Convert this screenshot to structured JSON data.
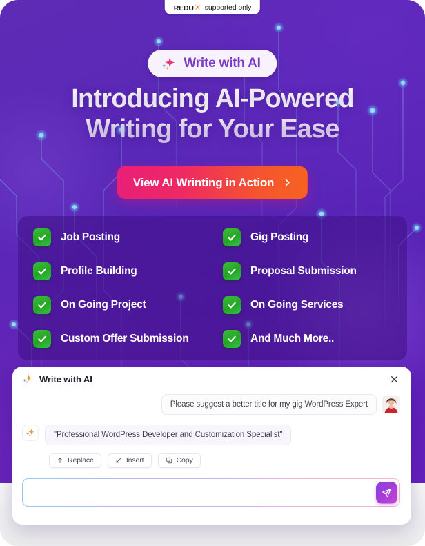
{
  "badge": {
    "brand": "REDU",
    "brand_mark": "X",
    "note": "supported only",
    "colors": {
      "mark_start": "#f5c518",
      "mark_mid": "#f0722c",
      "mark_end": "#e8327c"
    }
  },
  "pill": {
    "label": "Write with AI",
    "icon": "sparkle-icon",
    "text_color": "#7a3cc4"
  },
  "hero": {
    "headline_line1": "Introducing AI-Powered",
    "headline_line2": "Writing for Your Ease",
    "cta_label": "View AI Wrinting in Action",
    "cta_icon": "chevron-right-icon",
    "cta_gradient_start": "#e81f78",
    "cta_gradient_end": "#f76321",
    "background_start": "#5e2bb5",
    "background_end": "#6520bd"
  },
  "features": {
    "check_color": "#2aac2a",
    "items": [
      {
        "label": "Job Posting"
      },
      {
        "label": "Gig Posting"
      },
      {
        "label": "Profile Building"
      },
      {
        "label": "Proposal Submission"
      },
      {
        "label": "On Going Project"
      },
      {
        "label": "On Going Services"
      },
      {
        "label": "Custom Offer Submission"
      },
      {
        "label": "And Much More.."
      }
    ]
  },
  "chat": {
    "title": "Write with AI",
    "title_icon": "sparkle-icon",
    "close_icon": "close-icon",
    "user_message": "Please suggest a better title for my gig WordPress Expert",
    "ai_message": "\"Professional WordPress Developer and Customization Specialist\"",
    "actions": [
      {
        "label": "Replace",
        "icon": "arrow-up-icon"
      },
      {
        "label": "Insert",
        "icon": "arrow-down-left-icon"
      },
      {
        "label": "Copy",
        "icon": "copy-icon"
      }
    ],
    "composer": {
      "value": "",
      "placeholder": "",
      "send_icon": "send-icon",
      "send_gradient_start": "#8b3fe0",
      "send_gradient_end": "#cb45cf"
    }
  }
}
